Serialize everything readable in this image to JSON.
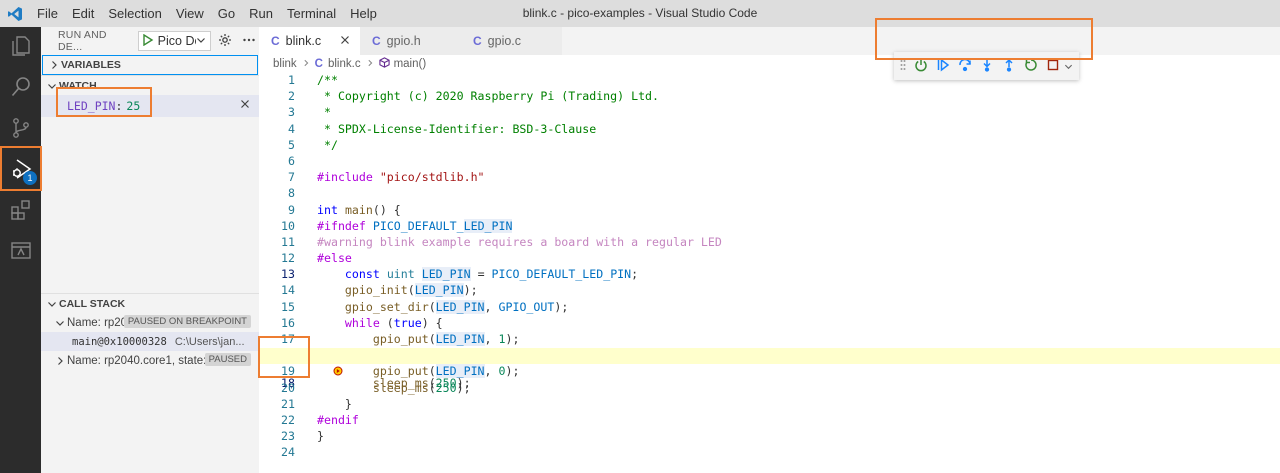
{
  "titlebar": {
    "menu": [
      "File",
      "Edit",
      "Selection",
      "View",
      "Go",
      "Run",
      "Terminal",
      "Help"
    ],
    "window_title": "blink.c - pico-examples - Visual Studio Code"
  },
  "activitybar": {
    "items": [
      "files-icon",
      "search-icon",
      "source-control-icon",
      "run-debug-icon",
      "extensions-icon",
      "remote-explorer-icon"
    ],
    "debug_badge": "1"
  },
  "sidebar": {
    "header_title": "RUN AND DE...",
    "config_value": "Pico De",
    "variables_label": "VARIABLES",
    "watch_label": "WATCH",
    "watch_items": [
      {
        "name": "LED_PIN",
        "value": "25"
      }
    ],
    "callstack_label": "CALL STACK",
    "callstack": {
      "thread0_name": "Name: rp20...",
      "thread0_status": "PAUSED ON BREAKPOINT",
      "frame_fn": "main@0x10000328",
      "frame_path": "C:\\Users\\jan...",
      "thread1_name": "Name: rp2040.core1, state:...",
      "thread1_status": "PAUSED"
    }
  },
  "editor": {
    "tabs": [
      {
        "label": "blink.c",
        "active": true
      },
      {
        "label": "gpio.h",
        "active": false
      },
      {
        "label": "gpio.c",
        "active": false
      }
    ],
    "breadcrumb": [
      "blink",
      "blink.c",
      "main()"
    ],
    "current_line": 18,
    "line_numbers": [
      "1",
      "2",
      "3",
      "4",
      "5",
      "6",
      "7",
      "8",
      "9",
      "10",
      "11",
      "12",
      "13",
      "14",
      "15",
      "16",
      "17",
      "18",
      "19",
      "20",
      "21",
      "22",
      "23",
      "24"
    ]
  },
  "debug_toolbar": {
    "buttons": [
      "disconnect-icon",
      "continue-icon",
      "step-over-icon",
      "step-into-icon",
      "step-out-icon",
      "restart-icon",
      "stop-icon"
    ]
  },
  "colors": {
    "accent": "#0e70c0",
    "callout": "#ed7d31",
    "current_line": "#ffffcc"
  }
}
